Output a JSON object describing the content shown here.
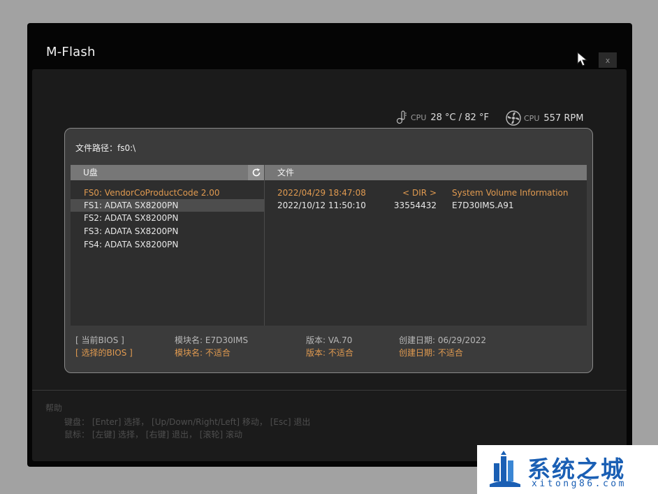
{
  "window": {
    "title": "M-Flash",
    "close_label": "x"
  },
  "hardware": {
    "cpu_temp_label": "CPU",
    "cpu_temp_value": "28 °C / 82 °F",
    "cpu_fan_label": "CPU",
    "cpu_fan_value": "557 RPM"
  },
  "dialog": {
    "path_label": "文件路径：fs0:\\",
    "left_header": "U盘",
    "right_header": "文件",
    "drives": [
      "FS0: VendorCoProductCode 2.00",
      "FS1: ADATA SX8200PN",
      "FS2: ADATA SX8200PN",
      "FS3: ADATA SX8200PN",
      "FS4: ADATA SX8200PN"
    ],
    "files": [
      {
        "date": "2022/04/29 18:47:08",
        "size": "< DIR >",
        "name": "System Volume Information"
      },
      {
        "date": "2022/10/12 11:50:10",
        "size": "33554432",
        "name": "E7D30IMS.A91"
      }
    ],
    "current_bios": {
      "label": "[    当前BIOS    ]",
      "module": "模块名: E7D30IMS",
      "version": "版本: VA.70",
      "date": "创建日期: 06/29/2022"
    },
    "selected_bios": {
      "label": "[  选择的BIOS  ]",
      "module": "模块名: 不适合",
      "version": "版本: 不适合",
      "date": "创建日期: 不适合"
    }
  },
  "help": {
    "title": "帮助",
    "keyboard": "键盘：  [Enter] 选择，  [Up/Down/Right/Left] 移动，  [Esc] 退出",
    "mouse": "鼠标：  [左键] 选择，  [右键] 退出，  [滚轮] 滚动"
  },
  "watermark": {
    "name": "系统之城",
    "url": "xitong86.com"
  },
  "colors": {
    "accent": "#e09a50",
    "watermark": "#1a5fb4"
  }
}
